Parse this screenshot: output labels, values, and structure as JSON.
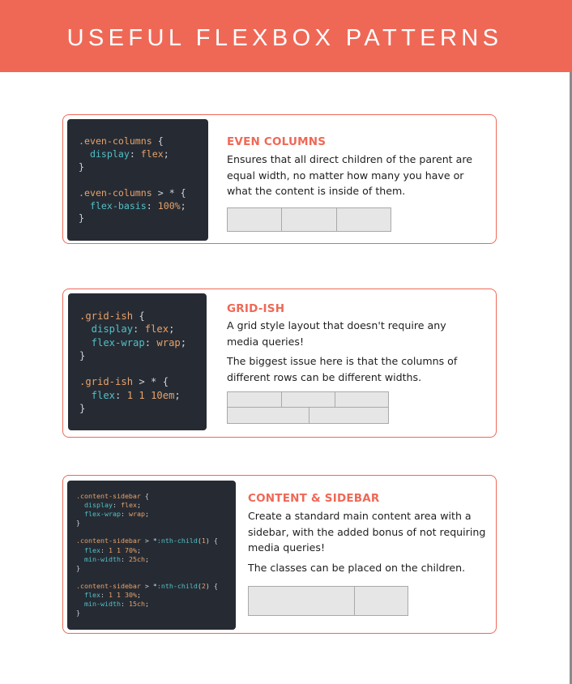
{
  "header": {
    "title": "USEFUL FLEXBOX PATTERNS"
  },
  "colors": {
    "accent": "#ef6856",
    "code_bg": "#262b33",
    "box_fill": "#e6e6e6"
  },
  "cards": [
    {
      "title": "EVEN COLUMNS",
      "description": [
        "Ensures that all direct children of the parent are equal width, no matter how many you have or what the content is inside of them."
      ],
      "code": [
        [
          {
            "t": ".even-columns",
            "c": "sel"
          },
          {
            "t": " {",
            "c": "pun"
          }
        ],
        [
          {
            "t": "  display",
            "c": "prop"
          },
          {
            "t": ": ",
            "c": "pun"
          },
          {
            "t": "flex",
            "c": "val"
          },
          {
            "t": ";",
            "c": "pun"
          }
        ],
        [
          {
            "t": "}",
            "c": "pun"
          }
        ],
        [],
        [
          {
            "t": ".even-columns",
            "c": "sel"
          },
          {
            "t": " > * {",
            "c": "pun"
          }
        ],
        [
          {
            "t": "  flex-basis",
            "c": "prop"
          },
          {
            "t": ": ",
            "c": "pun"
          },
          {
            "t": "100%",
            "c": "val"
          },
          {
            "t": ";",
            "c": "pun"
          }
        ],
        [
          {
            "t": "}",
            "c": "pun"
          }
        ]
      ]
    },
    {
      "title": "GRID-ISH",
      "description": [
        "A grid style layout that doesn't require any media queries!",
        "The biggest issue here is that the columns of different rows can be different widths."
      ],
      "code": [
        [
          {
            "t": ".grid-ish",
            "c": "sel"
          },
          {
            "t": " {",
            "c": "pun"
          }
        ],
        [
          {
            "t": "  display",
            "c": "prop"
          },
          {
            "t": ": ",
            "c": "pun"
          },
          {
            "t": "flex",
            "c": "val"
          },
          {
            "t": ";",
            "c": "pun"
          }
        ],
        [
          {
            "t": "  flex-wrap",
            "c": "prop"
          },
          {
            "t": ": ",
            "c": "pun"
          },
          {
            "t": "wrap",
            "c": "val"
          },
          {
            "t": ";",
            "c": "pun"
          }
        ],
        [
          {
            "t": "}",
            "c": "pun"
          }
        ],
        [],
        [
          {
            "t": ".grid-ish",
            "c": "sel"
          },
          {
            "t": " > * {",
            "c": "pun"
          }
        ],
        [
          {
            "t": "  flex",
            "c": "prop"
          },
          {
            "t": ": ",
            "c": "pun"
          },
          {
            "t": "1 1 10em",
            "c": "val"
          },
          {
            "t": ";",
            "c": "pun"
          }
        ],
        [
          {
            "t": "}",
            "c": "pun"
          }
        ]
      ]
    },
    {
      "title": "CONTENT & SIDEBAR",
      "description": [
        "Create a standard main content area with a sidebar, with the added bonus of not requiring media queries!",
        "The classes can be placed on the children."
      ],
      "code": [
        [
          {
            "t": ".content-sidebar",
            "c": "sel"
          },
          {
            "t": " {",
            "c": "pun"
          }
        ],
        [
          {
            "t": "  display",
            "c": "prop"
          },
          {
            "t": ": ",
            "c": "pun"
          },
          {
            "t": "flex",
            "c": "val"
          },
          {
            "t": ";",
            "c": "pun"
          }
        ],
        [
          {
            "t": "  flex-wrap",
            "c": "prop"
          },
          {
            "t": ": ",
            "c": "pun"
          },
          {
            "t": "wrap",
            "c": "val"
          },
          {
            "t": ";",
            "c": "pun"
          }
        ],
        [
          {
            "t": "}",
            "c": "pun"
          }
        ],
        [],
        [
          {
            "t": ".content-sidebar",
            "c": "sel"
          },
          {
            "t": " > *",
            "c": "pun"
          },
          {
            "t": ":nth-child",
            "c": "prop"
          },
          {
            "t": "(",
            "c": "pun"
          },
          {
            "t": "1",
            "c": "val"
          },
          {
            "t": ") {",
            "c": "pun"
          }
        ],
        [
          {
            "t": "  flex",
            "c": "prop"
          },
          {
            "t": ": ",
            "c": "pun"
          },
          {
            "t": "1 1 70%",
            "c": "val"
          },
          {
            "t": ";",
            "c": "pun"
          }
        ],
        [
          {
            "t": "  min-width",
            "c": "prop"
          },
          {
            "t": ": ",
            "c": "pun"
          },
          {
            "t": "25ch",
            "c": "val"
          },
          {
            "t": ";",
            "c": "pun"
          }
        ],
        [
          {
            "t": "}",
            "c": "pun"
          }
        ],
        [],
        [
          {
            "t": ".content-sidebar",
            "c": "sel"
          },
          {
            "t": " > *",
            "c": "pun"
          },
          {
            "t": ":nth-child",
            "c": "prop"
          },
          {
            "t": "(",
            "c": "pun"
          },
          {
            "t": "2",
            "c": "val"
          },
          {
            "t": ") {",
            "c": "pun"
          }
        ],
        [
          {
            "t": "  flex",
            "c": "prop"
          },
          {
            "t": ": ",
            "c": "pun"
          },
          {
            "t": "1 1 30%",
            "c": "val"
          },
          {
            "t": ";",
            "c": "pun"
          }
        ],
        [
          {
            "t": "  min-width",
            "c": "prop"
          },
          {
            "t": ": ",
            "c": "pun"
          },
          {
            "t": "15ch",
            "c": "val"
          },
          {
            "t": ";",
            "c": "pun"
          }
        ],
        [
          {
            "t": "}",
            "c": "pun"
          }
        ]
      ]
    }
  ]
}
